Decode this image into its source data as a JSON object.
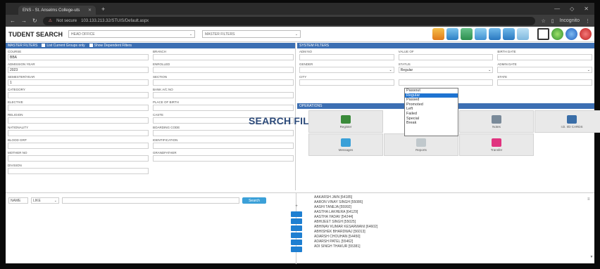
{
  "browser": {
    "tab_title": "ENS - St. Anselms College-uts",
    "tab_close": "✕",
    "new_tab": "+",
    "security": "Not secure",
    "url": "103.133.213.32/STUIS/Default.aspx",
    "profile": "Incognito"
  },
  "header": {
    "title": "TUDENT SEARCH",
    "office_select": "HEAD OFFICE",
    "filters_select": "MASTER FILTERS"
  },
  "master_filters": {
    "heading": "MASTER FILTERS",
    "opt1": "List Current Groups only",
    "opt2": "Show Dependent Filters",
    "fields": [
      {
        "label": "Course",
        "value": "BBA"
      },
      {
        "label": "Branch",
        "value": ""
      },
      {
        "label": "Admission Year",
        "value": "2023"
      },
      {
        "label": "Enrolled",
        "value": ""
      },
      {
        "label": "Semester/Year",
        "value": "1"
      },
      {
        "label": "Section",
        "value": ""
      },
      {
        "label": "Category",
        "value": ""
      },
      {
        "label": "Bank A/c No",
        "value": ""
      },
      {
        "label": "Elective",
        "value": ""
      },
      {
        "label": "Place of Birth",
        "value": ""
      },
      {
        "label": "Religion",
        "value": ""
      },
      {
        "label": "Caste",
        "value": ""
      },
      {
        "label": "Nationality",
        "value": ""
      },
      {
        "label": "Boarding Code",
        "value": ""
      },
      {
        "label": "Blood Grp",
        "value": ""
      },
      {
        "label": "Identification",
        "value": ""
      },
      {
        "label": "Mother No",
        "value": ""
      },
      {
        "label": "Grandfather",
        "value": ""
      },
      {
        "label": "Division",
        "value": ""
      }
    ]
  },
  "overlay_text": "SEARCH FILTERS",
  "system_filters": {
    "heading": "SYSTEM FILTERS",
    "fields": [
      {
        "label": "Adm No",
        "value": ""
      },
      {
        "label": "Value Of",
        "value": ""
      },
      {
        "label": "Birth Date",
        "value": ""
      },
      {
        "label": "Gender",
        "value": ""
      },
      {
        "label": "Status",
        "value": "Regular"
      },
      {
        "label": "Admin Date",
        "value": ""
      },
      {
        "label": "City",
        "value": ""
      },
      {
        "label": "",
        "value": ""
      },
      {
        "label": "State",
        "value": ""
      }
    ],
    "status_options": [
      "Passout",
      "Regular",
      "Passed",
      "Promoted",
      "Left",
      "Failed",
      "Special",
      "Break"
    ],
    "status_selected_index": 1
  },
  "operations": {
    "heading": "OPERATIONS",
    "tiles": [
      {
        "label": "Register"
      },
      {
        "label": ""
      },
      {
        "label": "Notes"
      },
      {
        "label": "I.D. I/D CARDS"
      },
      {
        "label": "Messages"
      },
      {
        "label": "Reports"
      },
      {
        "label": "Transfer"
      }
    ]
  },
  "search": {
    "field": "NAME",
    "op": "LIKE",
    "button": "Search"
  },
  "students": [
    "AAKARSH JAIN [64185]",
    "AARON VINAY SINGH [55086]",
    "AASHI TANEJA [55992]",
    "AASTHA LAKHERA [64129]",
    "AASTHA YADAV [54244]",
    "ABHIJEET SINGH [55025]",
    "ABHINAV KUMAR KESARWANI [64602]",
    "ABHISHEK BHARDWAJ [56013]",
    "ADARSH CHOUHAN [54450]",
    "ADARSH PATEL [55462]",
    "ADI SINGH THAKUR [55381]"
  ],
  "colors": {
    "accent": "#3c6fb3",
    "selected": "#1e73d1",
    "button": "#3ba0d8"
  }
}
